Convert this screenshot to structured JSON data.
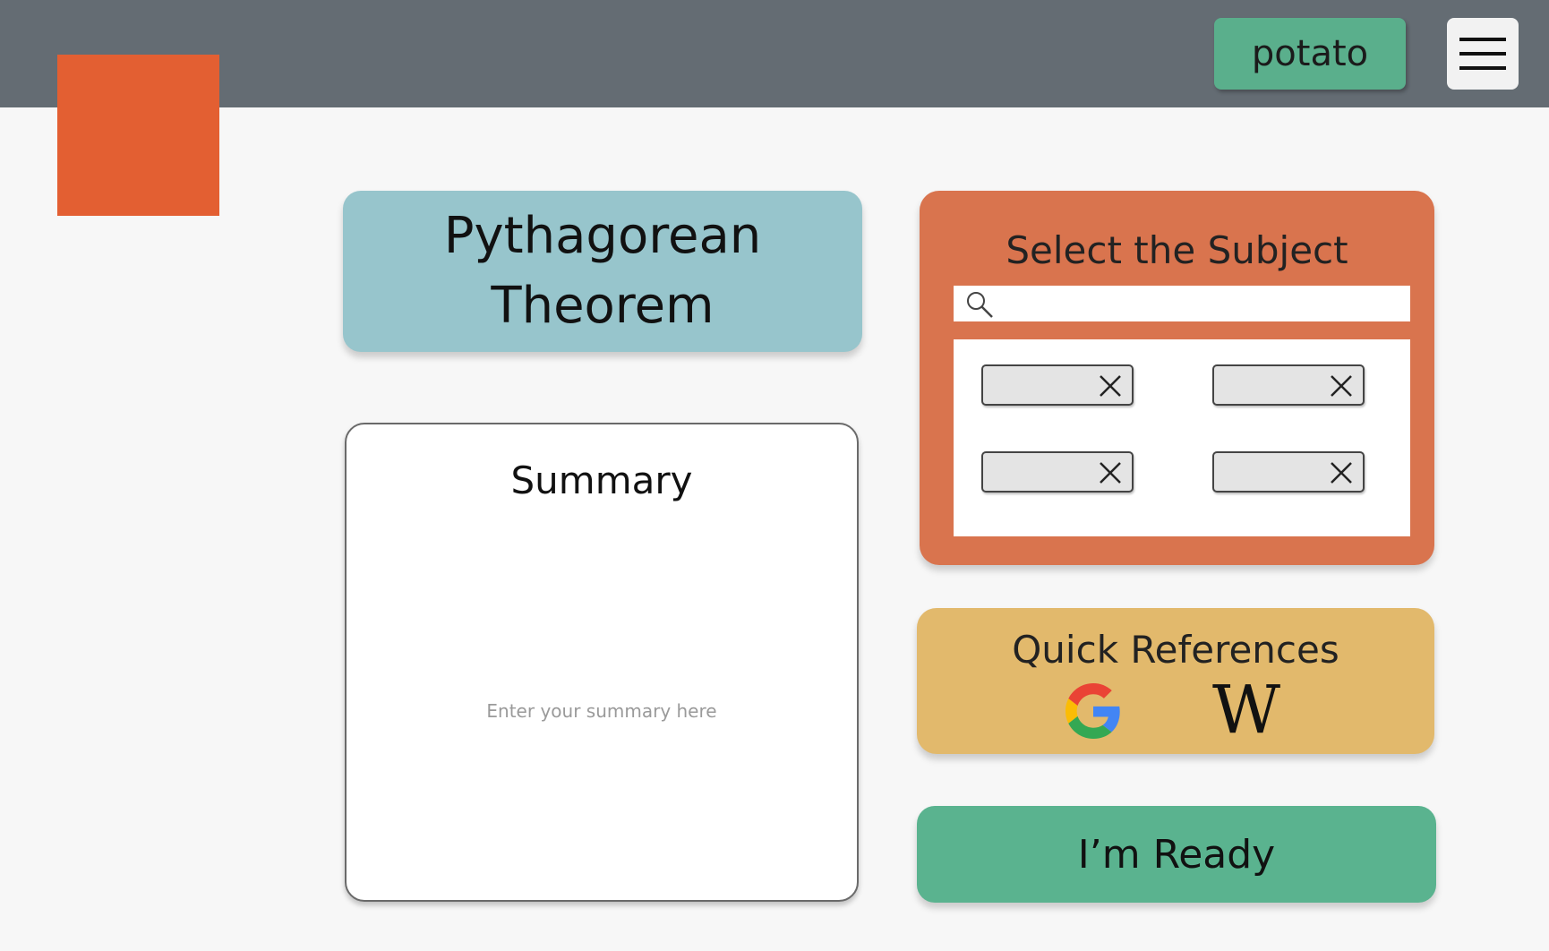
{
  "header": {
    "user_button_label": "potato"
  },
  "title_card": {
    "text": "Pythagorean\nTheorem"
  },
  "summary": {
    "title": "Summary",
    "placeholder": "Enter your summary here",
    "value": ""
  },
  "subject": {
    "title": "Select the Subject",
    "search_placeholder": "",
    "search_value": ""
  },
  "quick_references": {
    "title": "Quick References",
    "links": [
      "google-icon",
      "wikipedia-icon"
    ],
    "wiki_glyph": "W"
  },
  "ready_button": {
    "label": "I’m Ready"
  },
  "colors": {
    "topbar": "#646c73",
    "logo": "#e35f32",
    "green": "#5aaf8c",
    "title_card": "#97c5cc",
    "subject_panel": "#d9744e",
    "quick_references": "#e2b96c"
  }
}
